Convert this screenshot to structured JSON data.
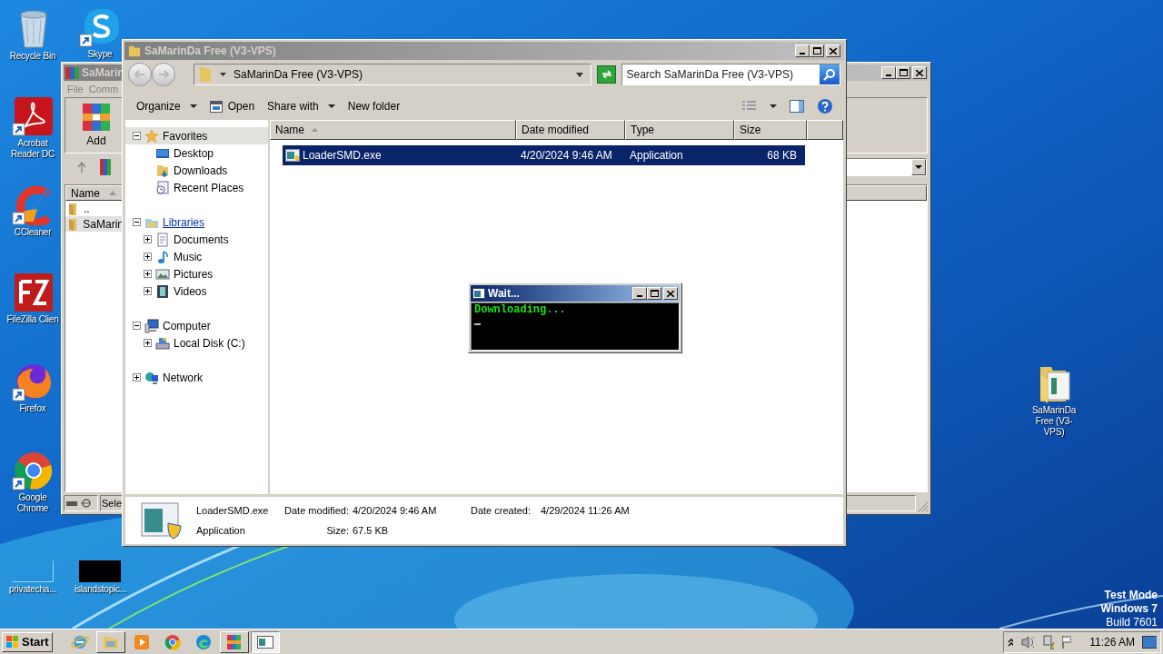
{
  "desktop_icons": [
    {
      "label": "Recycle Bin",
      "kind": "recycle",
      "shortcut": false
    },
    {
      "label": "Skype",
      "kind": "skype",
      "shortcut": true
    },
    {
      "label": "Acrobat Reader DC",
      "kind": "acrobat",
      "shortcut": true
    },
    {
      "label": "CCleaner",
      "kind": "ccleaner",
      "shortcut": true
    },
    {
      "label": "FileZilla Clien",
      "kind": "filezilla",
      "shortcut": false
    },
    {
      "label": "Firefox",
      "kind": "firefox",
      "shortcut": true
    },
    {
      "label": "Google Chrome",
      "kind": "chrome",
      "shortcut": true
    },
    {
      "label": "privatecha...",
      "kind": "blank",
      "shortcut": false
    },
    {
      "label": "islandstopic...",
      "kind": "black",
      "shortcut": false
    },
    {
      "label": "SaMarinDa Free (V3-VPS)",
      "kind": "folder",
      "shortcut": false
    }
  ],
  "winrar_window": {
    "title": "SaMarin",
    "menu": [
      "File",
      "Comm"
    ],
    "toolbar": [
      "Add"
    ],
    "column": "Name",
    "rows": [
      {
        "name": "..",
        "selected": false
      },
      {
        "name": "SaMarin",
        "selected": true
      }
    ],
    "status": "Sele"
  },
  "explorer": {
    "title": "SaMarinDa Free (V3-VPS)",
    "address": "SaMarinDa Free (V3-VPS)",
    "search_placeholder": "Search SaMarinDa Free (V3-VPS)",
    "toolbar": [
      {
        "label": "Organize",
        "kind": "menu"
      },
      {
        "label": "Open",
        "kind": "open"
      },
      {
        "label": "Share with",
        "kind": "menu"
      },
      {
        "label": "New folder",
        "kind": "plain"
      }
    ],
    "nav": [
      {
        "label": "Favorites",
        "kind": "favorites",
        "expanded": true,
        "selected": true,
        "hovered": false,
        "children": [
          {
            "label": "Desktop",
            "kind": "desktop",
            "selected": false
          },
          {
            "label": "Downloads",
            "kind": "downloads",
            "selected": false
          },
          {
            "label": "Recent Places",
            "kind": "recent",
            "selected": false
          }
        ]
      },
      {
        "label": "Libraries",
        "kind": "libraries",
        "expanded": true,
        "selected": false,
        "hovered": true,
        "children": [
          {
            "label": "Documents",
            "kind": "documents",
            "expanded": false,
            "selected": false
          },
          {
            "label": "Music",
            "kind": "music",
            "expanded": false,
            "selected": false
          },
          {
            "label": "Pictures",
            "kind": "pictures",
            "expanded": false,
            "selected": false
          },
          {
            "label": "Videos",
            "kind": "videos",
            "expanded": false,
            "selected": false
          }
        ]
      },
      {
        "label": "Computer",
        "kind": "computer",
        "expanded": true,
        "selected": false,
        "hovered": false,
        "children": [
          {
            "label": "Local Disk (C:)",
            "kind": "disk",
            "expanded": false,
            "selected": false
          }
        ]
      },
      {
        "label": "Network",
        "kind": "network",
        "expanded": false,
        "selected": false,
        "hovered": false
      }
    ],
    "columns": [
      {
        "label": "Name",
        "sorted": true
      },
      {
        "label": "Date modified",
        "sorted": false
      },
      {
        "label": "Type",
        "sorted": false
      },
      {
        "label": "Size",
        "sorted": false
      }
    ],
    "rows": [
      {
        "name": "LoaderSMD.exe",
        "date": "4/20/2024 9:46 AM",
        "type": "Application",
        "size": "68 KB",
        "selected": true
      }
    ],
    "details": {
      "name": "LoaderSMD.exe",
      "type": "Application",
      "fields": [
        {
          "label": "Date modified:",
          "value": "4/20/2024 9:46 AM"
        },
        {
          "label": "Size:",
          "value": "67.5 KB"
        },
        {
          "label": "Date created:",
          "value": "4/29/2024 11:26 AM"
        }
      ]
    }
  },
  "console_window": {
    "title": "Wait...",
    "lines": [
      "Downloading..."
    ]
  },
  "os_notice": [
    {
      "text": "Test Mode",
      "bold": true
    },
    {
      "text": "Windows 7",
      "bold": true
    },
    {
      "text": "Build 7601",
      "bold": false
    }
  ],
  "taskbar": {
    "start": "Start",
    "items": [
      {
        "kind": "ie",
        "open": false,
        "selected": false
      },
      {
        "kind": "explorer",
        "open": true,
        "selected": false
      },
      {
        "kind": "media",
        "open": false,
        "selected": false
      },
      {
        "kind": "chrome",
        "open": false,
        "selected": false
      },
      {
        "kind": "edge",
        "open": false,
        "selected": false
      },
      {
        "kind": "winrar",
        "open": true,
        "selected": false
      },
      {
        "kind": "console",
        "open": true,
        "selected": true
      }
    ],
    "clock": "11:26 AM"
  }
}
